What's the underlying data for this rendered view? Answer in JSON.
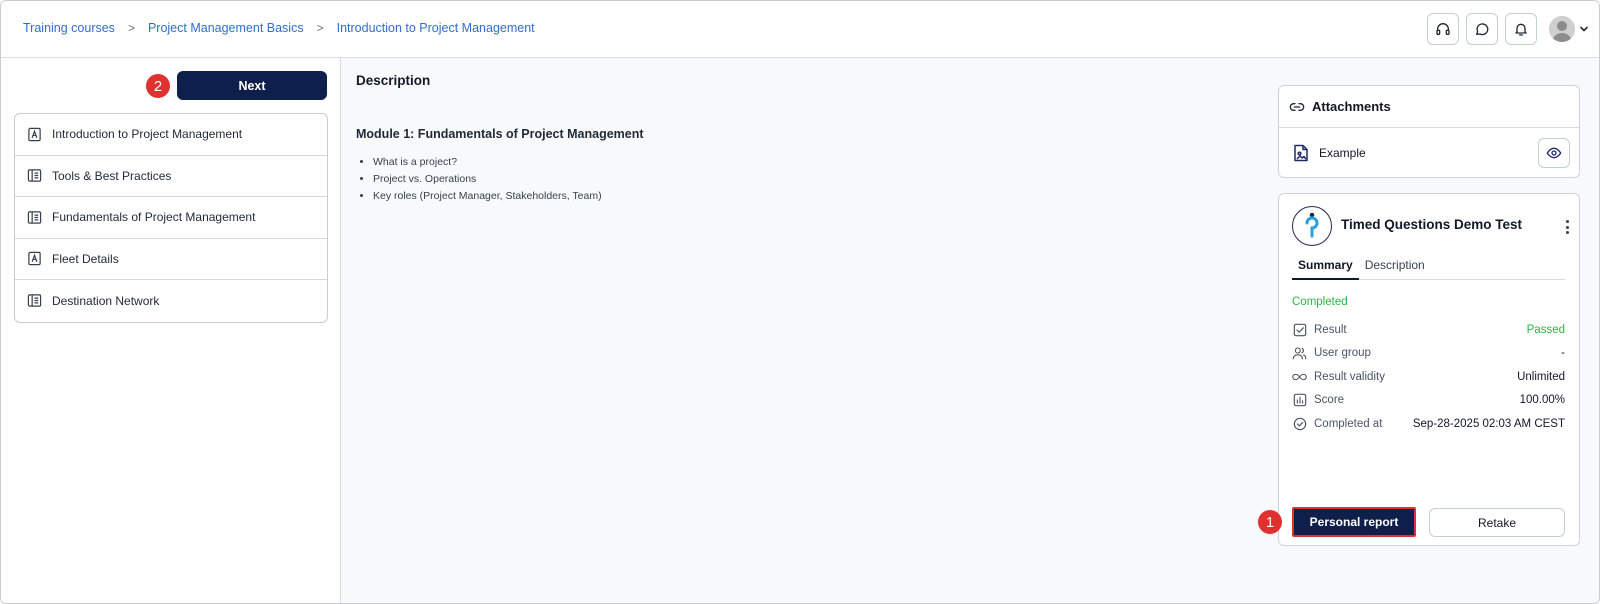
{
  "breadcrumb": {
    "items": [
      "Training courses",
      "Project Management Basics",
      "Introduction to Project Management"
    ],
    "separator": ">"
  },
  "topbar": {
    "icons": [
      "headset-icon",
      "chat-icon",
      "bell-icon",
      "user-avatar",
      "chevron-down-icon"
    ]
  },
  "sidebar": {
    "step_badge": "2",
    "next_label": "Next",
    "lessons": [
      {
        "label": "Introduction to Project Management",
        "icon": "assessment-icon"
      },
      {
        "label": "Tools & Best Practices",
        "icon": "book-icon"
      },
      {
        "label": "Fundamentals of Project Management",
        "icon": "book-icon"
      },
      {
        "label": "Fleet Details",
        "icon": "assessment-icon"
      },
      {
        "label": "Destination Network",
        "icon": "book-icon"
      }
    ]
  },
  "main": {
    "description_title": "Description",
    "module_title": "Module 1: Fundamentals of Project Management",
    "bullets": [
      "What is a project?",
      "Project vs. Operations",
      "Key roles (Project Manager, Stakeholders, Team)"
    ]
  },
  "attachments": {
    "title": "Attachments",
    "file_name": "Example"
  },
  "test": {
    "title": "Timed Questions Demo Test",
    "tabs": [
      "Summary",
      "Description"
    ],
    "active_tab": "Summary",
    "status": "Completed",
    "rows": [
      {
        "label": "Result",
        "value": "Passed",
        "icon": "checkbox-icon"
      },
      {
        "label": "User group",
        "value": "-",
        "icon": "users-icon"
      },
      {
        "label": "Result validity",
        "value": "Unlimited",
        "icon": "infinity-icon"
      },
      {
        "label": "Score",
        "value": "100.00%",
        "icon": "chart-icon"
      },
      {
        "label": "Completed at",
        "value": "Sep-28-2025 02:03 AM CEST",
        "icon": "check-circle-icon"
      }
    ],
    "step_badge": "1",
    "personal_report_label": "Personal report",
    "retake_label": "Retake"
  },
  "colors": {
    "primary_navy": "#0f1f4b",
    "link_blue": "#2f6fcf",
    "success_green": "#2fb344",
    "badge_red": "#e03131"
  }
}
